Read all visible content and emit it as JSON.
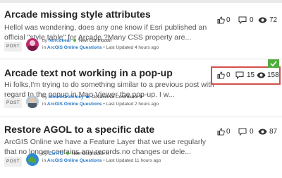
{
  "posts": [
    {
      "title": "Arcade missing style attributes",
      "body": "Hellol was wondering, does any one know if Esri published an official \"style table\" for Arcade ?Many CSS property are...",
      "badge": "POST",
      "by_prefix": "by",
      "author": "Norcokeai",
      "rank": "New Contributor",
      "in_prefix": "in",
      "board": "ArcGIS Online Questions",
      "updated": "• Last Updated 4 hours ago",
      "likes": "0",
      "replies": "0",
      "views": "72"
    },
    {
      "title": "Arcade text not working in a pop-up",
      "body": "Hi folks,I'm trying to do something similar to a previous post with regard to the popup in Map Viewer the pop-up. I w...",
      "badge": "POST",
      "by_prefix": "by",
      "author": "SimonCrutchley",
      "rank": "Occasional Contributor II",
      "in_prefix": "in",
      "board": "ArcGIS Online Questions",
      "updated": "• Last Updated 2 hours ago",
      "likes": "0",
      "replies": "15",
      "views": "158"
    },
    {
      "title": "Restore AGOL to a specific date",
      "body": "ArcGIS Online we have a Feature Layer that we use regularly that no longer contains any records.no changes or dele...",
      "badge": "POST",
      "by_prefix": "by",
      "author": "EsriTG",
      "rank": "New Contributor II",
      "in_prefix": "in",
      "board": "ArcGIS Online Questions",
      "updated": "• Last Updated 11 hours ago",
      "likes": "0",
      "replies": "0",
      "views": "87"
    }
  ],
  "colors": {
    "link": "#2879c6",
    "highlight": "#d4504a",
    "solved": "#4fad3c",
    "rank_dot_new": "#4fad3c",
    "rank_dot_occasional": "#2879c6"
  },
  "icons": {
    "likes": "thumbs-up-icon",
    "replies": "speech-bubble-icon",
    "views": "eye-icon",
    "solved": "checkmark-icon"
  }
}
